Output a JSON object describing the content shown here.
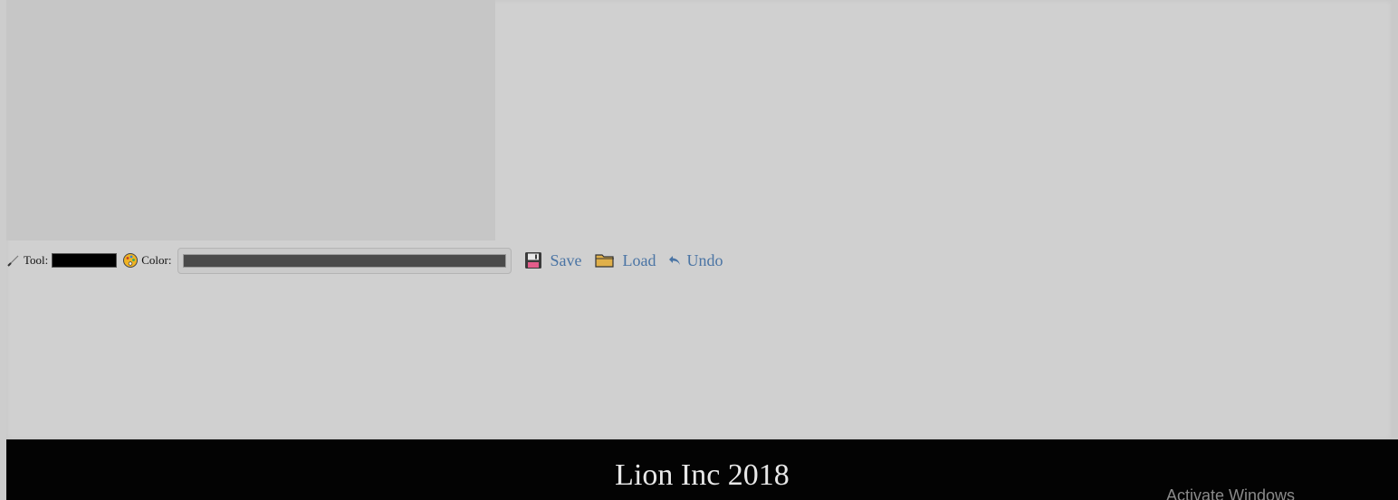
{
  "toolbar": {
    "tool_label": "Tool:",
    "tool_value_color": "#000000",
    "color_label": "Color:",
    "color_value": "#4a4a4a",
    "save_label": "Save",
    "load_label": "Load",
    "undo_label": "Undo",
    "icons": {
      "tool": "brush-icon",
      "color": "palette-icon",
      "save": "floppy-disk-icon",
      "load": "folder-icon",
      "undo": "undo-arrow-icon"
    }
  },
  "footer": {
    "title": "Lion Inc 2018"
  },
  "overlay": {
    "watermark": "Activate Windows"
  },
  "colors": {
    "link": "#4a74a4",
    "footer_bg": "#030303",
    "footer_text": "#e8e8e8"
  }
}
